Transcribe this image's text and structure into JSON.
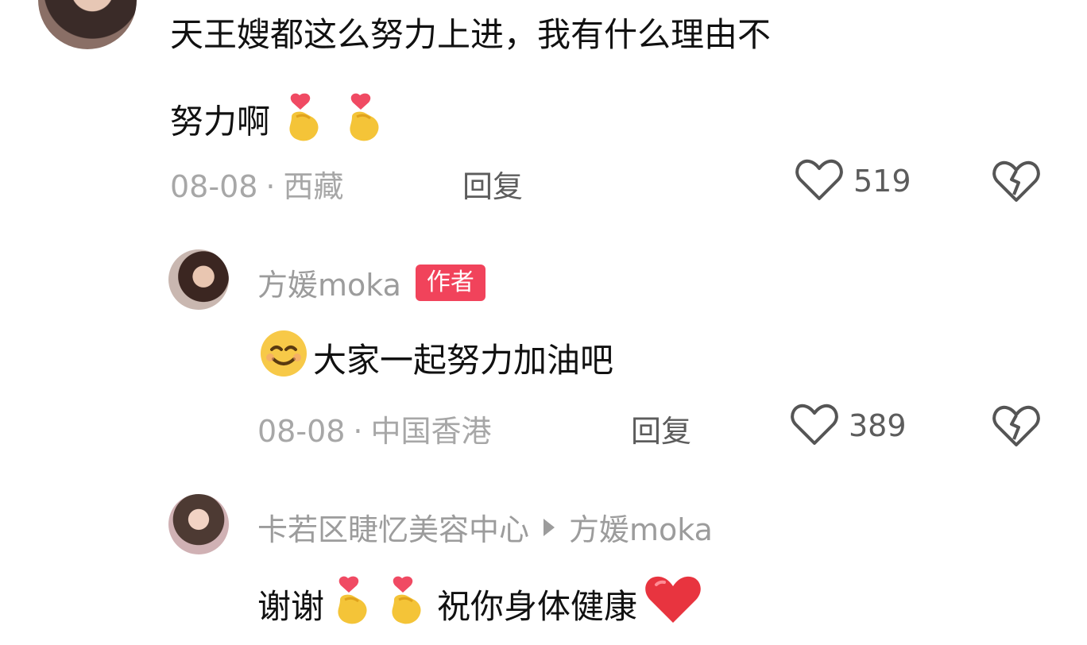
{
  "comments": [
    {
      "text_parts": [
        "天王嫂都这么努力上进，我有什么理由不",
        "努力啊"
      ],
      "date": "08-08",
      "location": "西藏",
      "reply_label": "回复",
      "likes": "519",
      "emojis": [
        "finger-heart",
        "finger-heart"
      ]
    },
    {
      "username": "方媛moka",
      "badge": "作者",
      "text": "大家一起努力加油吧",
      "date": "08-08",
      "location": "中国香港",
      "reply_label": "回复",
      "likes": "389",
      "emojis": [
        "smiling-face"
      ]
    },
    {
      "username": "卡若区睫忆美容中心",
      "reply_to": "方媛moka",
      "text_parts": [
        "谢谢",
        "祝你身体健康"
      ],
      "emojis": [
        "finger-heart",
        "finger-heart",
        "red-heart"
      ]
    }
  ],
  "separator": "·",
  "colors": {
    "badge": "#f1435b",
    "meta_text": "#a7a7a7",
    "name_text": "#9c9c9c",
    "icon_gray": "#555555"
  },
  "icons": {
    "like": "heart-outline-icon",
    "dislike": "broken-heart-icon",
    "reply_arrow": "play-triangle-icon"
  }
}
